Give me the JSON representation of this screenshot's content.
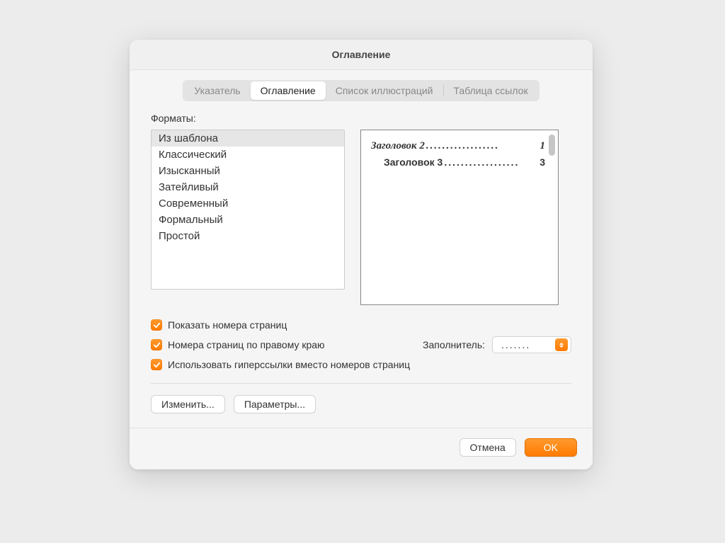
{
  "dialog": {
    "title": "Оглавление"
  },
  "tabs": {
    "index": "Указатель",
    "toc": "Оглавление",
    "figures": "Список иллюстраций",
    "refs": "Таблица ссылок"
  },
  "formats": {
    "label": "Форматы:",
    "items": [
      "Из шаблона",
      "Классический",
      "Изысканный",
      "Затейливый",
      "Современный",
      "Формальный",
      "Простой"
    ]
  },
  "preview": {
    "line1_text": "Заголовок 2",
    "line1_page": "1",
    "line2_text": "Заголовок 3",
    "line2_page": "3"
  },
  "checks": {
    "show_pages": "Показать номера страниц",
    "right_align": "Номера страниц по правому краю",
    "hyperlinks": "Использовать гиперссылки вместо номеров страниц"
  },
  "filler": {
    "label": "Заполнитель:",
    "value": "......."
  },
  "buttons": {
    "modify": "Изменить...",
    "options": "Параметры...",
    "cancel": "Отмена",
    "ok": "OK"
  }
}
